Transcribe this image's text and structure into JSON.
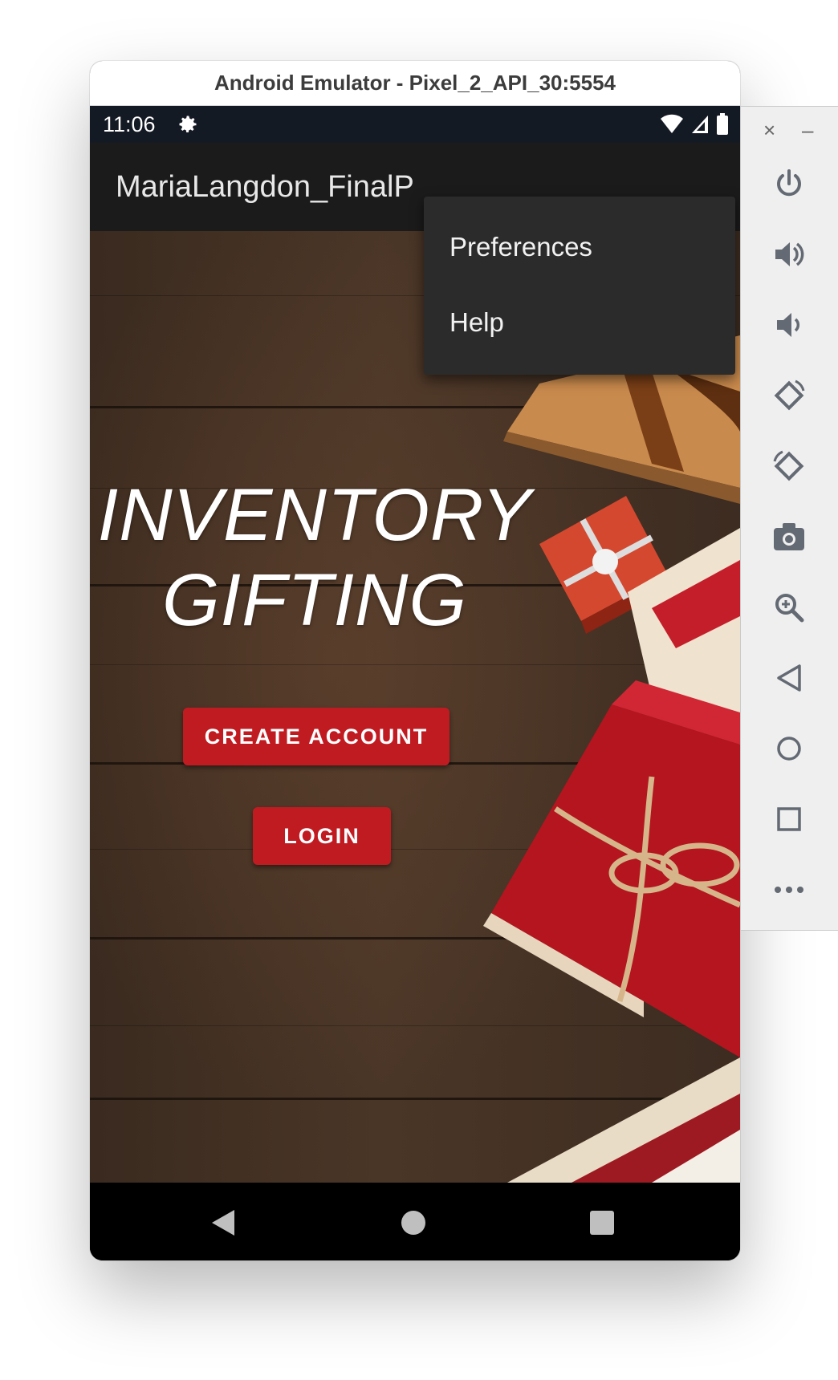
{
  "window": {
    "title": "Android Emulator - Pixel_2_API_30:5554"
  },
  "statusbar": {
    "time": "11:06",
    "icons": [
      "gear-icon",
      "wifi-icon",
      "signal-icon",
      "battery-icon"
    ]
  },
  "appbar": {
    "title": "MariaLangdon_FinalP"
  },
  "menu": {
    "items": [
      "Preferences",
      "Help"
    ]
  },
  "main": {
    "headline_line1": "INVENTORY",
    "headline_line2": "GIFTING",
    "create_account_label": "CREATE ACCOUNT",
    "login_label": "LOGIN"
  },
  "navbar": {
    "icons": [
      "back-icon",
      "home-icon",
      "recents-icon"
    ]
  },
  "sidebar": {
    "close_glyph": "×",
    "minimize_glyph": "–",
    "tools": [
      "power-icon",
      "volume-up-icon",
      "volume-down-icon",
      "rotate-left-icon",
      "rotate-right-icon",
      "camera-icon",
      "zoom-icon",
      "back-icon",
      "home-icon",
      "overview-icon",
      "more-icon"
    ]
  },
  "colors": {
    "accent_button": "#c11b22",
    "appbar": "#1b1b1b",
    "statusbar": "#141a24",
    "menu": "#2b2b2b"
  }
}
